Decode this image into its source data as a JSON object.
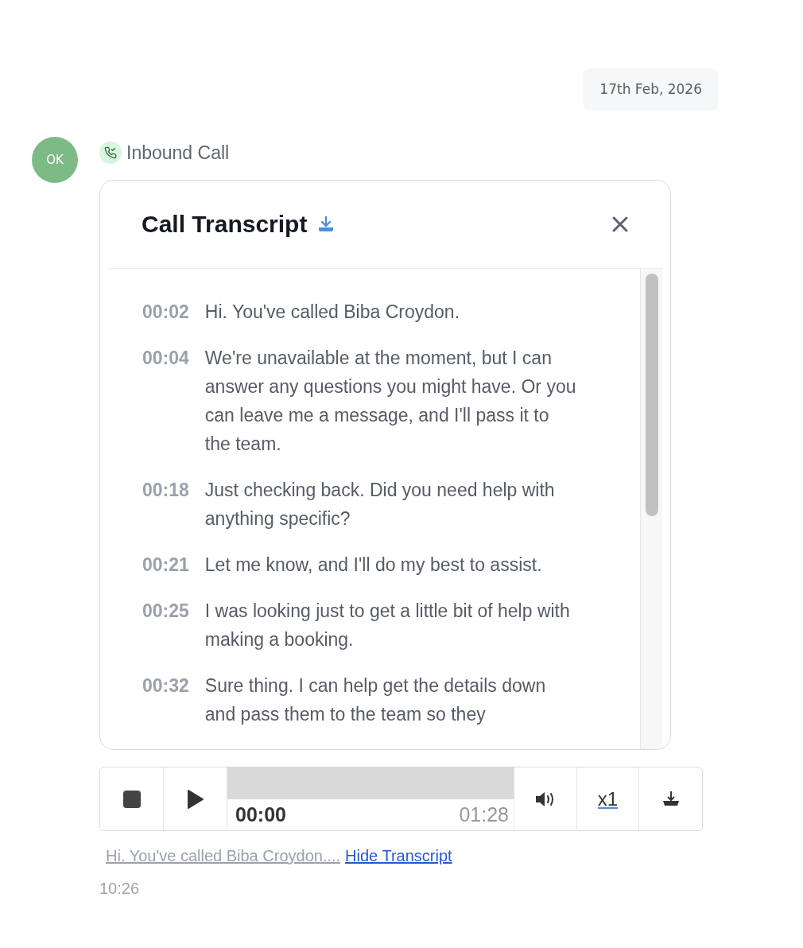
{
  "date_chip": "17th Feb, 2026",
  "avatar": {
    "initials": "OK"
  },
  "call": {
    "label": "Inbound Call"
  },
  "transcript_panel": {
    "title": "Call Transcript",
    "entries": [
      {
        "time": "00:02",
        "text": "Hi. You've called Biba Croydon."
      },
      {
        "time": "00:04",
        "text": "We're unavailable at the moment, but I can answer any questions you might have. Or you can leave me a message, and I'll pass it to the team."
      },
      {
        "time": "00:18",
        "text": "Just checking back. Did you need help with anything specific?"
      },
      {
        "time": "00:21",
        "text": "Let me know, and I'll do my best to assist."
      },
      {
        "time": "00:25",
        "text": "I was looking just to get a little bit of help with making a booking."
      },
      {
        "time": "00:32",
        "text": "Sure thing. I can help get the details down and pass them to the team so they"
      }
    ]
  },
  "player": {
    "elapsed": "00:00",
    "duration": "01:28",
    "speed": "x1"
  },
  "summary": {
    "preview": "Hi. You've called Biba Croydon....",
    "link": "Hide Transcript"
  },
  "timestamp": "10:26"
}
